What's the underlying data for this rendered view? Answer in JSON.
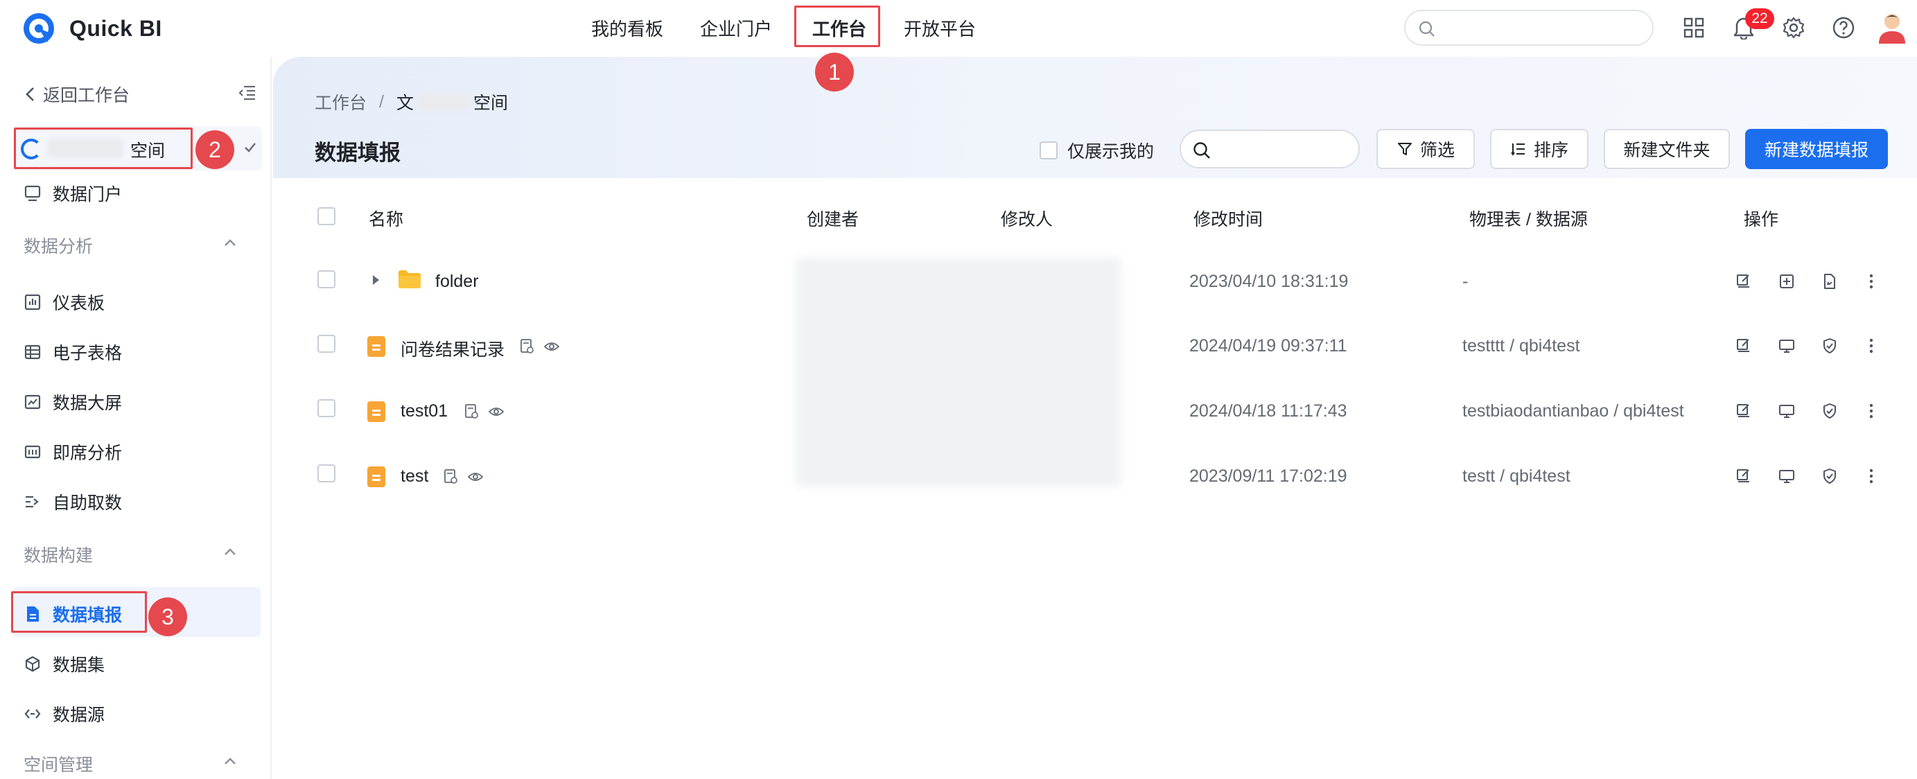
{
  "app": {
    "name": "Quick BI",
    "brand_color": "#1b6fee",
    "logo_icon": "quick-bi-logo-icon"
  },
  "top_nav": {
    "items": [
      {
        "label": "我的看板",
        "active": false
      },
      {
        "label": "企业门户",
        "active": false
      },
      {
        "label": "工作台",
        "active": true
      },
      {
        "label": "开放平台",
        "active": false
      }
    ],
    "search_placeholder": "",
    "notification_count": "22",
    "icons": [
      "apps-grid-icon",
      "bell-icon",
      "gear-icon",
      "help-circle-icon",
      "user-avatar"
    ]
  },
  "sidebar": {
    "back_label": "返回工作台",
    "space_name": "空间",
    "groups": [
      {
        "title": "",
        "items": [
          {
            "label": "数据门户",
            "icon": "portal-icon"
          }
        ]
      },
      {
        "title": "数据分析",
        "items": [
          {
            "label": "仪表板",
            "icon": "dashboard-icon"
          },
          {
            "label": "电子表格",
            "icon": "spreadsheet-icon"
          },
          {
            "label": "数据大屏",
            "icon": "big-screen-icon"
          },
          {
            "label": "即席分析",
            "icon": "adhoc-analysis-icon"
          },
          {
            "label": "自助取数",
            "icon": "self-service-fetch-icon"
          }
        ]
      },
      {
        "title": "数据构建",
        "items": [
          {
            "label": "数据填报",
            "icon": "data-entry-icon",
            "active": true
          },
          {
            "label": "数据集",
            "icon": "dataset-icon"
          },
          {
            "label": "数据源",
            "icon": "datasource-icon"
          }
        ]
      },
      {
        "title": "空间管理",
        "items": []
      }
    ]
  },
  "breadcrumb": {
    "root": "工作台",
    "separator": "/",
    "current_prefix": "文",
    "current_suffix": "空间"
  },
  "page": {
    "title": "数据填报",
    "only_mine_label": "仅展示我的",
    "search_placeholder": "",
    "filter_label": "筛选",
    "sort_label": "排序",
    "new_folder_label": "新建文件夹",
    "new_entry_label": "新建数据填报"
  },
  "table": {
    "columns": [
      "名称",
      "创建者",
      "修改人",
      "修改时间",
      "物理表 / 数据源",
      "操作"
    ],
    "rows": [
      {
        "type": "folder",
        "name": "folder",
        "modified": "2023/04/10 18:31:19",
        "source": "-",
        "ops": [
          "edit-icon",
          "add-box-icon",
          "export-file-icon",
          "more-icon"
        ]
      },
      {
        "type": "form",
        "name": "问卷结果记录",
        "modified": "2024/04/19 09:37:11",
        "source": "testttt / qbi4test",
        "ops": [
          "edit-icon",
          "monitor-icon",
          "shield-check-icon",
          "more-icon"
        ]
      },
      {
        "type": "form",
        "name": "test01",
        "modified": "2024/04/18 11:17:43",
        "source": "testbiaodantianbao / qbi4test",
        "ops": [
          "edit-icon",
          "monitor-icon",
          "shield-check-icon",
          "more-icon"
        ]
      },
      {
        "type": "form",
        "name": "test",
        "modified": "2023/09/11 17:02:19",
        "source": "testt / qbi4test",
        "ops": [
          "edit-icon",
          "monitor-icon",
          "shield-check-icon",
          "more-icon"
        ]
      }
    ]
  },
  "annotations": [
    {
      "label": "1",
      "target": "top-nav-workbench"
    },
    {
      "label": "2",
      "target": "space-selector"
    },
    {
      "label": "3",
      "target": "sidebar-item-data-entry"
    }
  ],
  "colors": {
    "annotation": "#e5484d",
    "form_icon": "#f7a534",
    "folder_icon": "#fbb821"
  }
}
